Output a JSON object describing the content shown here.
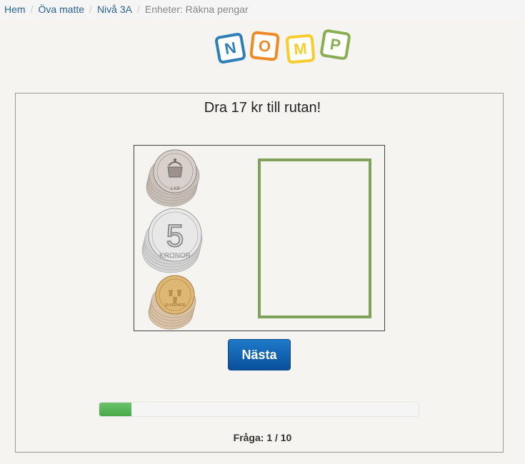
{
  "breadcrumb": {
    "items": [
      {
        "label": "Hem"
      },
      {
        "label": "Öva matte"
      },
      {
        "label": "Nivå 3A"
      }
    ],
    "current": "Enheter: Räkna pengar",
    "separator": "/"
  },
  "logo": {
    "letters": [
      {
        "char": "N",
        "color": "#2f7fb7"
      },
      {
        "char": "O",
        "color": "#ef8a24"
      },
      {
        "char": "M",
        "color": "#f6cd2a"
      },
      {
        "char": "P",
        "color": "#8aae52"
      }
    ]
  },
  "task": {
    "instruction": "Dra 17 kr till rutan!"
  },
  "coins": [
    {
      "name": "1 krona",
      "icon": "one-krona-coin"
    },
    {
      "name": "5 kronor",
      "icon": "five-kronor-coin"
    },
    {
      "name": "10 kronor",
      "icon": "ten-kronor-coin"
    }
  ],
  "next_button": {
    "label": "Nästa"
  },
  "progress": {
    "fraction": 0.1,
    "color": "#5cb85c"
  },
  "question_counter": "Fråga: 1 / 10"
}
